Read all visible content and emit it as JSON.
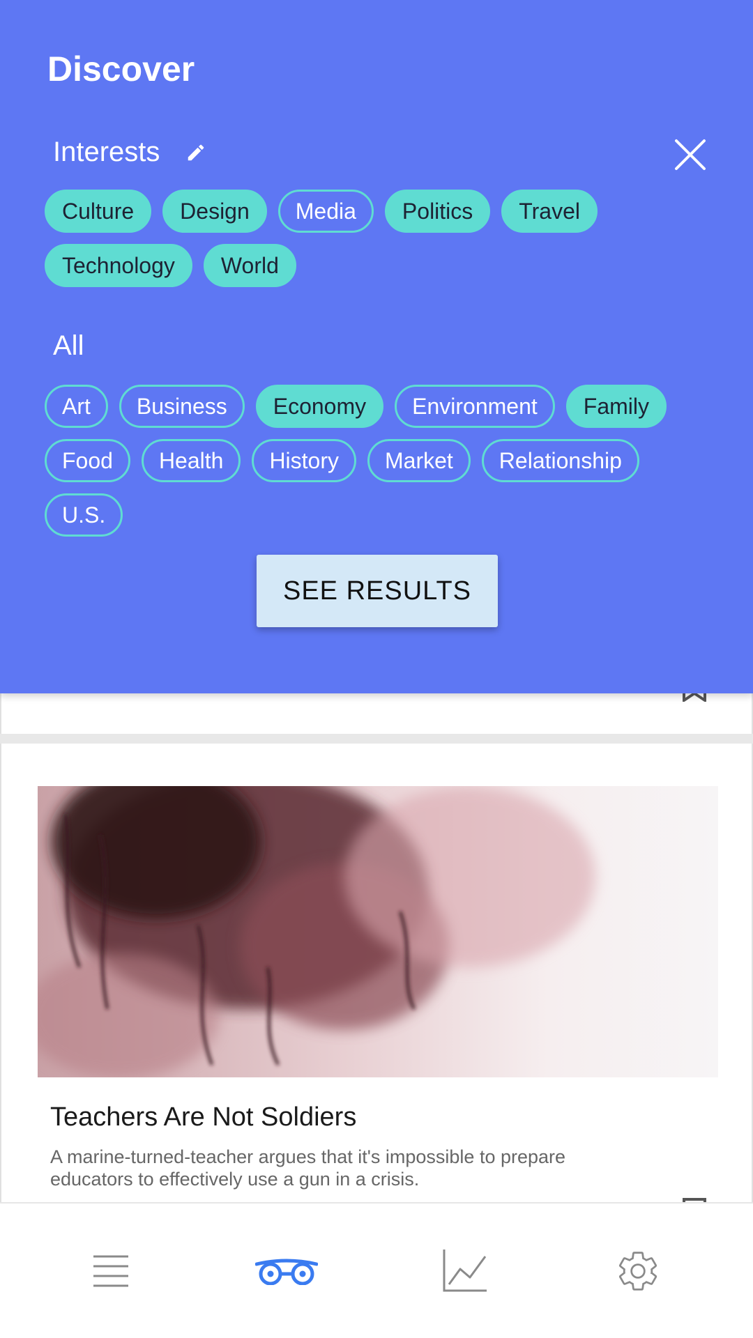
{
  "header": {
    "title": "Discover"
  },
  "interests": {
    "label": "Interests",
    "edit_icon": "pencil-icon",
    "tags": [
      {
        "label": "Culture",
        "selected": true
      },
      {
        "label": "Design",
        "selected": true
      },
      {
        "label": "Media",
        "selected": false
      },
      {
        "label": "Politics",
        "selected": true
      },
      {
        "label": "Travel",
        "selected": true
      },
      {
        "label": "Technology",
        "selected": true
      },
      {
        "label": "World",
        "selected": true
      }
    ]
  },
  "all": {
    "label": "All",
    "tags": [
      {
        "label": "Art",
        "selected": false
      },
      {
        "label": "Business",
        "selected": false
      },
      {
        "label": "Economy",
        "selected": true
      },
      {
        "label": "Environment",
        "selected": false
      },
      {
        "label": "Family",
        "selected": true
      },
      {
        "label": "Food",
        "selected": false
      },
      {
        "label": "Health",
        "selected": false
      },
      {
        "label": "History",
        "selected": false
      },
      {
        "label": "Market",
        "selected": false
      },
      {
        "label": "Relationship",
        "selected": false
      },
      {
        "label": "U.S.",
        "selected": false
      }
    ]
  },
  "close_icon": "close-icon",
  "see_results_label": "SEE RESULTS",
  "article": {
    "title": "Teachers Are Not Soldiers",
    "summary": "A marine-turned-teacher argues that it's impossible to prepare educators to effectively use a gun in a crisis."
  },
  "bottom_nav": {
    "items": [
      {
        "icon": "menu-icon",
        "active": false
      },
      {
        "icon": "discover-glasses-icon",
        "active": true
      },
      {
        "icon": "stats-chart-icon",
        "active": false
      },
      {
        "icon": "settings-gear-icon",
        "active": false
      }
    ]
  },
  "colors": {
    "overlay": "#5e77f3",
    "chip": "#5fdcd2",
    "button": "#d4e8f7",
    "nav_active": "#3a7bf0",
    "nav_inactive": "#8a8a8a"
  }
}
